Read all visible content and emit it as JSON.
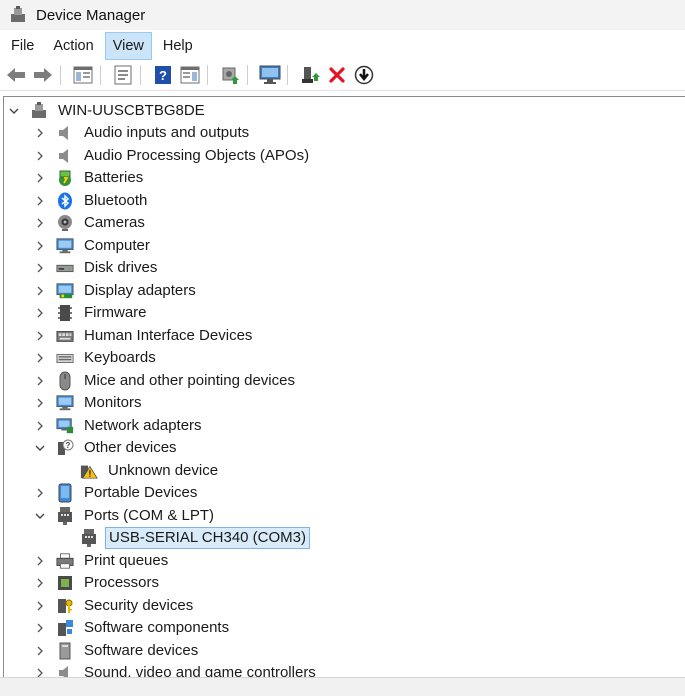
{
  "window": {
    "title": "Device Manager"
  },
  "menu": {
    "file": "File",
    "action": "Action",
    "view": "View",
    "help": "Help"
  },
  "toolbar": {
    "buttons": [
      "back-icon",
      "forward-icon",
      "show-hide-console-tree-icon",
      "properties-icon",
      "help-icon",
      "action-pane-icon",
      "update-driver-icon",
      "scan-hardware-icon",
      "enable-device-icon",
      "uninstall-device-icon",
      "disable-device-icon"
    ]
  },
  "tree": {
    "root": "WIN-UUSCBTBG8DE",
    "categories": [
      "Audio inputs and outputs",
      "Audio Processing Objects (APOs)",
      "Batteries",
      "Bluetooth",
      "Cameras",
      "Computer",
      "Disk drives",
      "Display adapters",
      "Firmware",
      "Human Interface Devices",
      "Keyboards",
      "Mice and other pointing devices",
      "Monitors",
      "Network adapters",
      "Other devices",
      "Unknown device",
      "Portable Devices",
      "Ports (COM & LPT)",
      "USB-SERIAL CH340 (COM3)",
      "Print queues",
      "Processors",
      "Security devices",
      "Software components",
      "Software devices",
      "Sound, video and game controllers"
    ]
  },
  "colors": {
    "selection_bg": "#d9ebf9",
    "selection_border": "#7fb4e6",
    "menu_active": "#cce4f7",
    "delete_red": "#e81123"
  }
}
